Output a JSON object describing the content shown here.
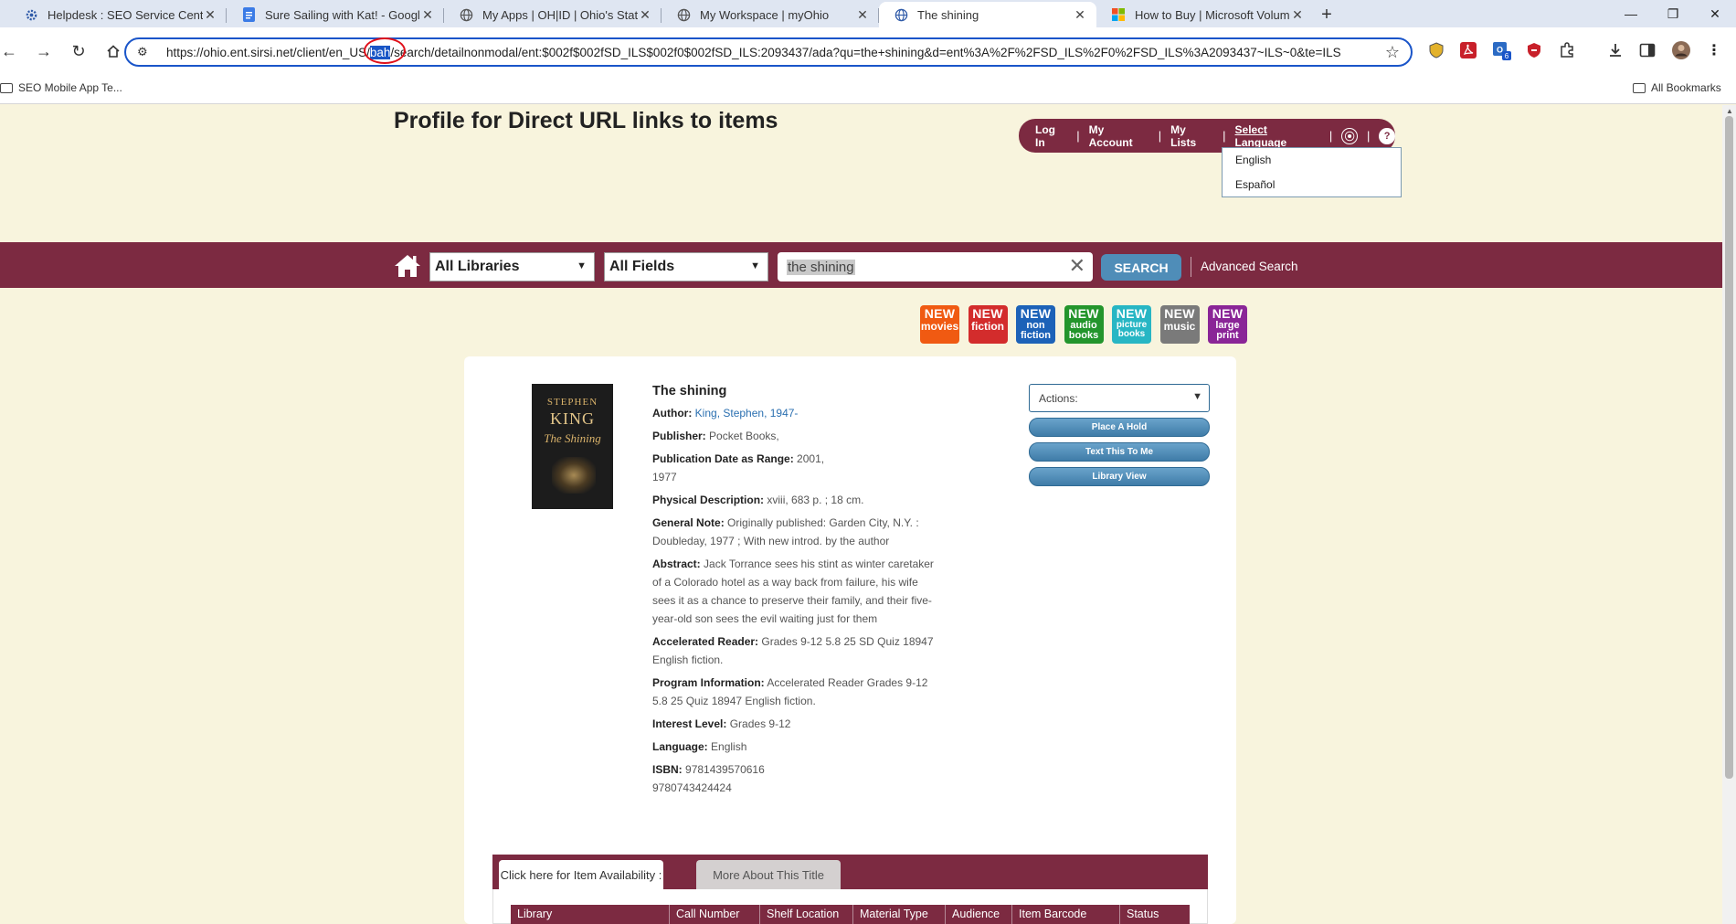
{
  "browser": {
    "tabs": [
      {
        "title": "Helpdesk : SEO Service Center",
        "icon": "gear-icon"
      },
      {
        "title": "Sure Sailing with Kat! - Google",
        "icon": "docs-icon"
      },
      {
        "title": "My Apps | OH|ID | Ohio's State",
        "icon": "globe-icon"
      },
      {
        "title": "My Workspace | myOhio",
        "icon": "globe-icon"
      },
      {
        "title": "The shining",
        "icon": "globe-icon",
        "active": true
      },
      {
        "title": "How to Buy | Microsoft Volume",
        "icon": "microsoft-icon"
      }
    ],
    "url_prefix": "https://ohio.ent.sirsi.net/client/en_US/",
    "url_highlight": "bah",
    "url_suffix": "/search/detailnonmodal/ent:$002f$002fSD_ILS$002f0$002fSD_ILS:2093437/ada?qu=the+shining&d=ent%3A%2F%2FSD_ILS%2F0%2FSD_ILS%3A2093437~ILS~0&te=ILS",
    "extension_badge": "6",
    "bookmarks": {
      "left": "SEO Mobile App Te...",
      "right": "All Bookmarks"
    }
  },
  "header": {
    "site_title": "Profile for Direct URL links to items",
    "nav": {
      "login": "Log In",
      "account": "My Account",
      "lists": "My Lists",
      "language": "Select Language"
    },
    "accessibility_glyph": "⦿",
    "help_glyph": "?",
    "languages": [
      "English",
      "Español"
    ]
  },
  "search": {
    "library": "All Libraries",
    "field": "All Fields",
    "query": "the shining",
    "button": "SEARCH",
    "advanced": "Advanced Search"
  },
  "new_icons": [
    {
      "top": "NEW",
      "label": "movies",
      "color": "#f05a12"
    },
    {
      "top": "NEW",
      "label": "fiction",
      "color": "#d32c2c"
    },
    {
      "top": "NEW",
      "label": "non fiction",
      "color": "#1c62b8"
    },
    {
      "top": "NEW",
      "label": "audio books",
      "color": "#23952c"
    },
    {
      "top": "NEW",
      "label": "picture books",
      "color": "#27b6c4"
    },
    {
      "top": "NEW",
      "label": "music",
      "color": "#7a7a7a"
    },
    {
      "top": "NEW",
      "label": "large print",
      "color": "#8a2597"
    }
  ],
  "cover": {
    "line1": "STEPHEN",
    "line2": "KING",
    "line3": "The Shining"
  },
  "item": {
    "title": "The shining",
    "author_label": "Author:",
    "author": "King, Stephen, 1947-",
    "publisher_label": "Publisher:",
    "publisher": "Pocket Books,",
    "pubdate_label": "Publication Date as Range:",
    "pubdate_1": "2001,",
    "pubdate_2": "1977",
    "physical_label": "Physical Description:",
    "physical": "xviii, 683 p. ; 18 cm.",
    "general_label": "General Note:",
    "general": "Originally published: Garden City, N.Y. : Doubleday, 1977 ; With new introd. by the author",
    "abstract_label": "Abstract:",
    "abstract": "Jack Torrance sees his stint as winter caretaker of a Colorado hotel as a way back from failure, his wife sees it as a chance to preserve their family, and their five-year-old son sees the evil waiting just for them",
    "ar_label": "Accelerated Reader:",
    "ar": "Grades 9-12 5.8 25 SD Quiz 18947 English fiction.",
    "program_label": "Program Information:",
    "program": "Accelerated Reader Grades 9-12 5.8 25 Quiz 18947 English fiction.",
    "interest_label": "Interest Level:",
    "interest": "Grades 9-12",
    "language_label": "Language:",
    "language": "English",
    "isbn_label": "ISBN:",
    "isbn_1": "9781439570616",
    "isbn_2": "9780743424424"
  },
  "actions": {
    "select": "Actions:",
    "buttons": [
      "Place A Hold",
      "Text This To Me",
      "Library View"
    ]
  },
  "detail_tabs": {
    "availability": "Click here for Item Availability :",
    "more": "More About This Title"
  },
  "table_headers": [
    "Library",
    "Call Number",
    "Shelf Location",
    "Material Type",
    "Audience",
    "Item Barcode",
    "Status"
  ]
}
